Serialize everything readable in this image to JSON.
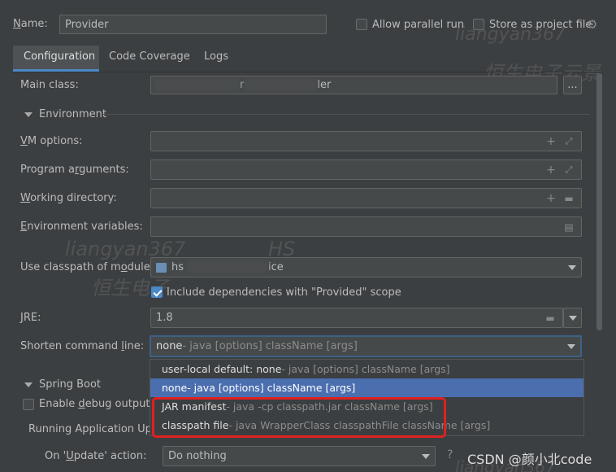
{
  "header": {
    "name_label": "Name:",
    "name_value": "Provider",
    "allow_parallel_label": "Allow parallel run",
    "store_project_label": "Store as project file"
  },
  "tabs": [
    {
      "label": "Configuration"
    },
    {
      "label": "Code Coverage"
    },
    {
      "label": "Logs"
    }
  ],
  "form": {
    "main_class_label": "Main class:",
    "main_class_value_a": "r",
    "main_class_value_b": "ler",
    "browse_label": "...",
    "environment_title": "Environment",
    "vm_options_label": "VM options:",
    "program_args_label": "Program arguments:",
    "working_dir_label": "Working directory:",
    "env_vars_label": "Environment variables:",
    "classpath_module_label": "Use classpath of module:",
    "classpath_module_value_a": "hs",
    "classpath_module_value_b": "ice",
    "include_deps_label": "Include dependencies with \"Provided\" scope",
    "jre_label": "JRE:",
    "jre_value": "1.8",
    "shorten_label": "Shorten command line:",
    "shorten_value_main": "none",
    "shorten_value_hint": " - java [options] className [args]",
    "spring_boot_title": "Spring Boot",
    "enable_debug_label": "Enable debug output",
    "running_update_label": "Running Application Upd",
    "on_update_label": "On 'Update' action:",
    "on_update_value": "Do nothing"
  },
  "popup": {
    "items": [
      {
        "main": "user-local default: none",
        "hint": " - java [options] className [args]"
      },
      {
        "main": "none",
        "hint": " - java [options] className [args]"
      },
      {
        "main": "JAR manifest",
        "hint": " - java -cp classpath.jar className [args]"
      },
      {
        "main": "classpath file",
        "hint": " - java WrapperClass classpathFile className [args]"
      }
    ]
  },
  "watermarks": {
    "w1": "liangyan367",
    "w2": "恒生电子云景",
    "w3": "liangyan367",
    "w4": "HS",
    "w5": "恒生电子",
    "w6": "liangyan367",
    "w7": "CSDN @颜小北code"
  },
  "colors": {
    "background": "#3c3f41",
    "field": "#45494a",
    "selection": "#4b6eaf",
    "highlight_box": "#e02020"
  }
}
